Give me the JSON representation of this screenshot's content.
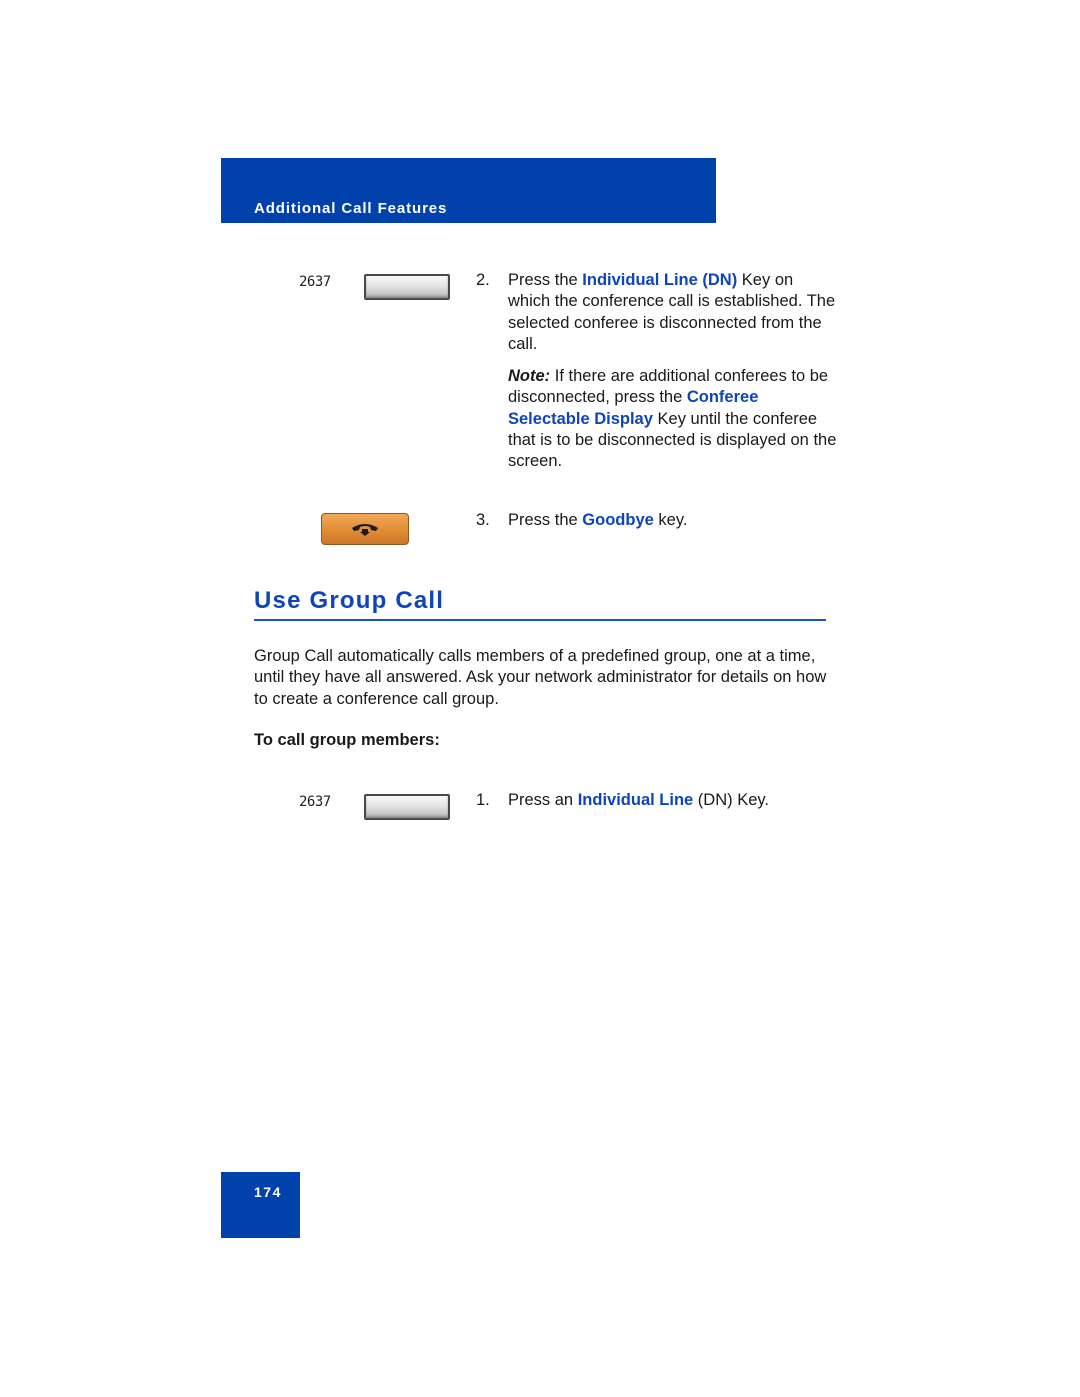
{
  "header": {
    "section_title": "Additional Call Features"
  },
  "keys": {
    "dn_label": "2637",
    "line_key_icon": "blank-line-key",
    "goodbye_key_icon": "handset-hangup-icon"
  },
  "steps_top": [
    {
      "number": "2.",
      "parts": [
        "Press the ",
        "Individual Line (DN)",
        " Key on which the conference call is established. The selected conferee is disconnected from the call."
      ],
      "note": {
        "label": "Note:",
        "parts": [
          " If there are additional conferees to be disconnected, press the ",
          "Conferee Selectable Display",
          " Key until the conferee that is to be disconnected is displayed on the screen."
        ]
      }
    },
    {
      "number": "3.",
      "parts": [
        "Press the ",
        "Goodbye",
        " key."
      ]
    }
  ],
  "section": {
    "title": "Use Group Call",
    "description": "Group Call automatically calls members of a predefined group, one at a time, until they have all answered. Ask your network administrator for details on how to create a conference call group.",
    "subheading": "To call group members:",
    "steps": [
      {
        "number": "1.",
        "parts": [
          "Press an ",
          "Individual Line",
          " (DN) Key."
        ]
      }
    ]
  },
  "footer": {
    "page_number": "174"
  },
  "colors": {
    "brand_blue": "#0041ab",
    "link_blue": "#0f45b5",
    "goodbye_orange": "#e08a32"
  }
}
